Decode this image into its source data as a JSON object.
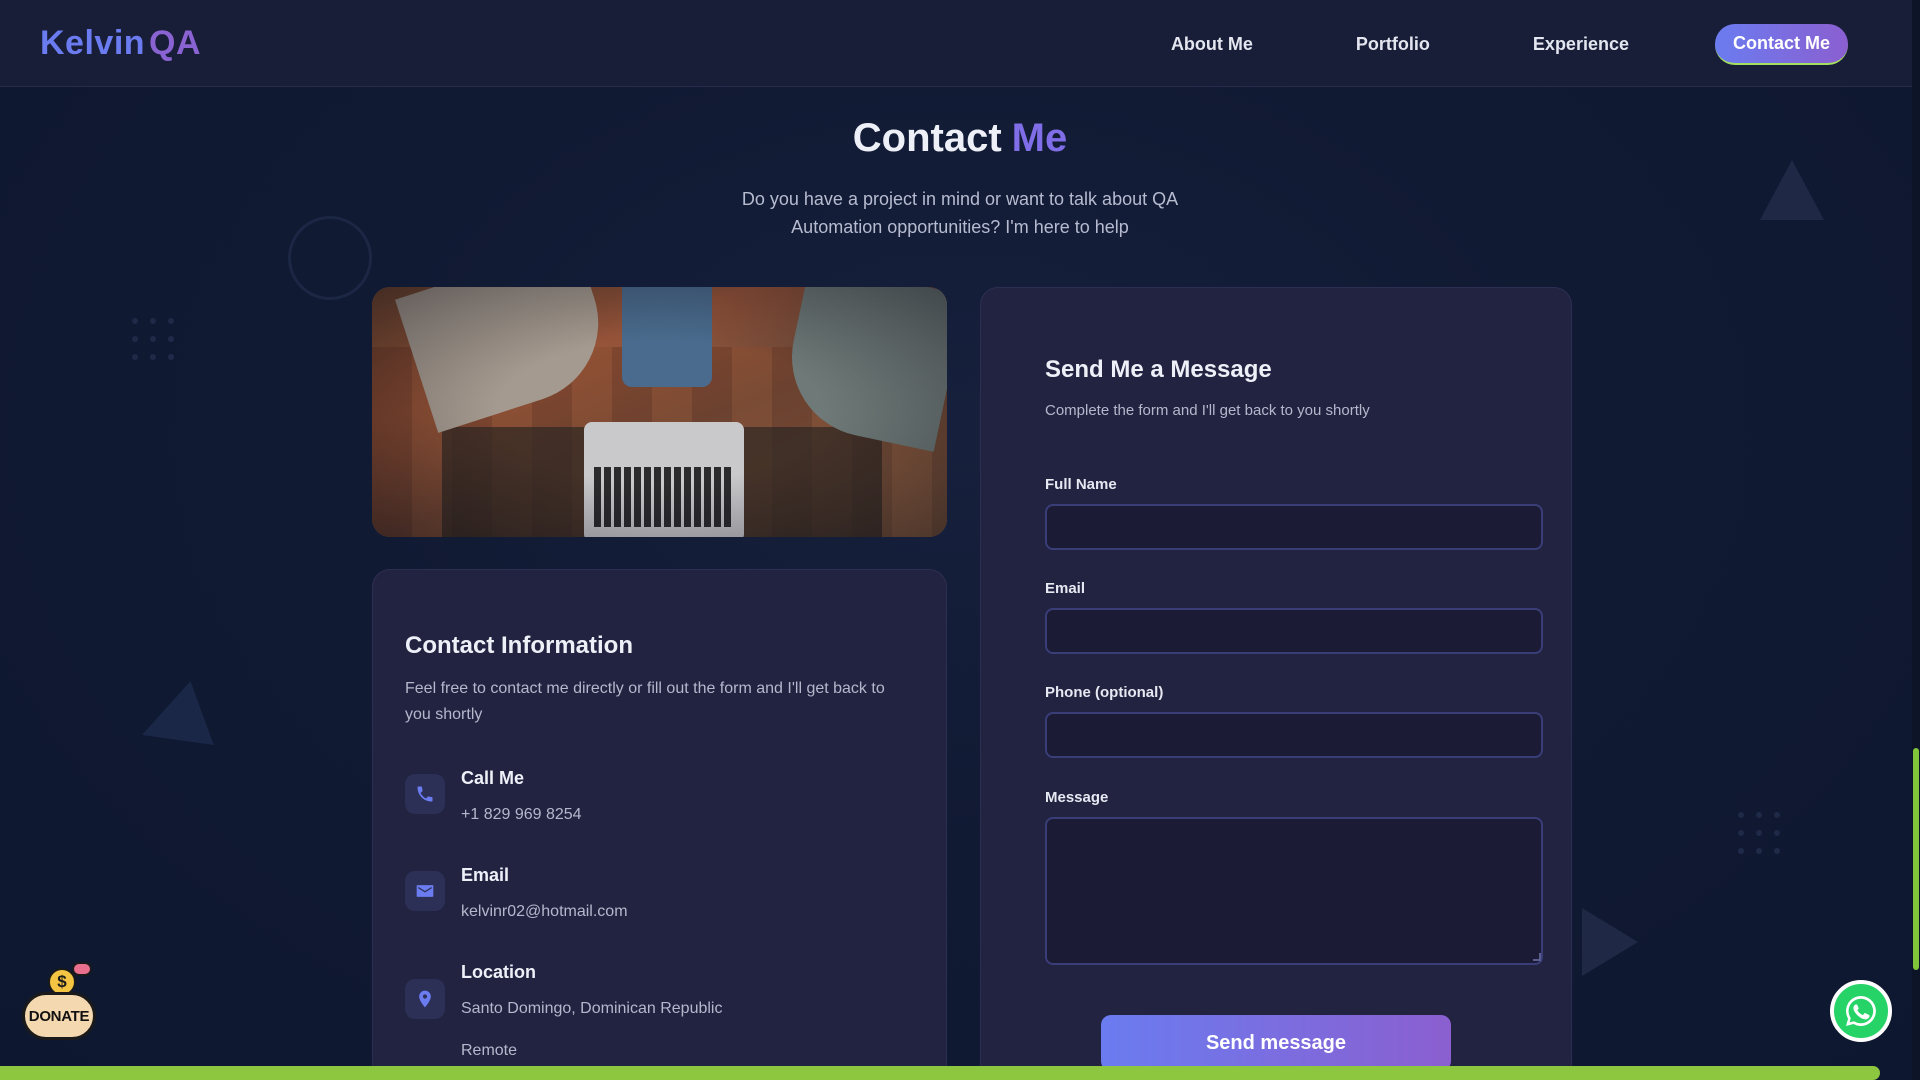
{
  "header": {
    "logo_part1": "Kelvin",
    "logo_part2": "QA",
    "nav": [
      {
        "label": "About Me"
      },
      {
        "label": "Portfolio"
      },
      {
        "label": "Experience"
      },
      {
        "label": "Contact Me",
        "active": true
      }
    ]
  },
  "hero": {
    "title_part1": "Contact",
    "title_part2": "Me",
    "subtitle": "Do you have a project in mind or want to talk about QA Automation opportunities? I'm here to help"
  },
  "contact_info": {
    "title": "Contact Information",
    "text": "Feel free to contact me directly or fill out the form and I'll get back to you shortly",
    "items": [
      {
        "icon": "phone-icon",
        "label": "Call Me",
        "value": "+1 829 969 8254"
      },
      {
        "icon": "mail-icon",
        "label": "Email",
        "value": "kelvinr02@hotmail.com"
      },
      {
        "icon": "location-icon",
        "label": "Location",
        "value": "Santo Domingo, Dominican Republic",
        "extra": "Remote"
      }
    ]
  },
  "form": {
    "title": "Send Me a Message",
    "subtitle": "Complete the form and I'll get back to you shortly",
    "fields": [
      {
        "label": "Full Name",
        "value": ""
      },
      {
        "label": "Email",
        "value": ""
      },
      {
        "label": "Phone (optional)",
        "value": ""
      },
      {
        "label": "Message",
        "value": ""
      }
    ],
    "submit_label": "Send message"
  },
  "floating": {
    "donate_label": "DONATE",
    "donate_coin": "$"
  },
  "colors": {
    "accent_blue": "#6a7cf0",
    "accent_purple": "#8b5fd0",
    "progress_green": "#8dc63f",
    "whatsapp_green": "#25d366"
  }
}
